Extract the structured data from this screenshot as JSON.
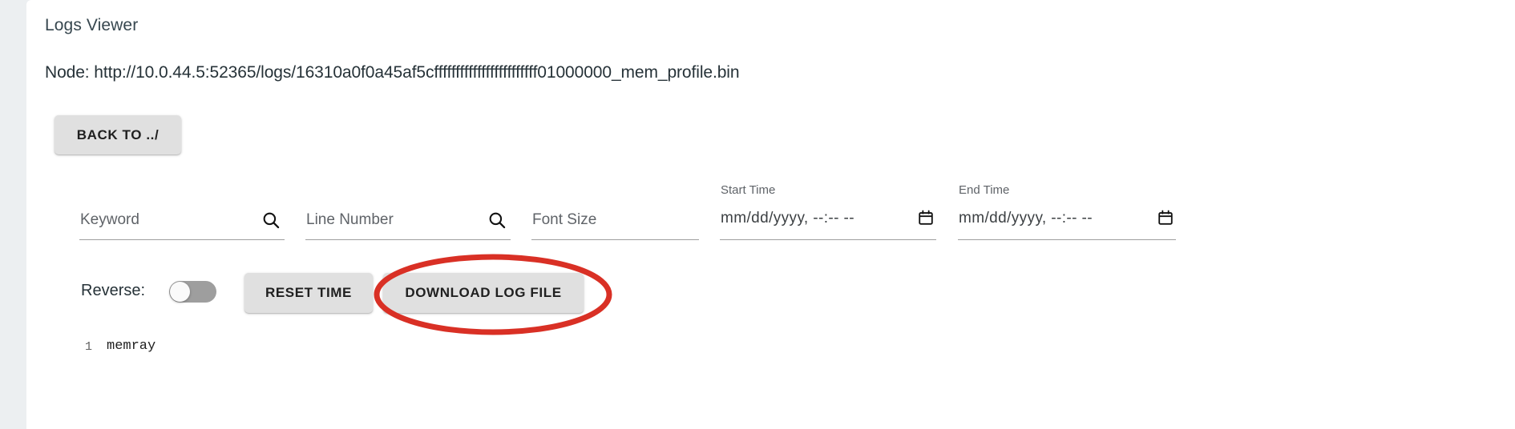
{
  "header": {
    "title": "Logs Viewer",
    "node_line": "Node: http://10.0.44.5:52365/logs/16310a0f0a45af5cffffffffffffffffffffffff01000000_mem_profile.bin"
  },
  "nav": {
    "back_label": "BACK TO ../"
  },
  "filters": {
    "keyword": {
      "placeholder": "Keyword",
      "value": "",
      "icon": "search-icon"
    },
    "line_number": {
      "placeholder": "Line Number",
      "value": "",
      "icon": "search-icon"
    },
    "font_size": {
      "placeholder": "Font Size",
      "value": ""
    },
    "start_time": {
      "label": "Start Time",
      "placeholder": "mm/dd/yyyy, --:-- --",
      "value": "mm/dd/yyyy, --:-- --",
      "icon": "calendar-icon"
    },
    "end_time": {
      "label": "End Time",
      "placeholder": "mm/dd/yyyy, --:-- --",
      "value": "mm/dd/yyyy, --:-- --",
      "icon": "calendar-icon"
    }
  },
  "controls": {
    "reverse_label": "Reverse:",
    "reverse_on": false,
    "reset_time_label": "RESET TIME",
    "download_label": "DOWNLOAD LOG FILE"
  },
  "annotation": {
    "shape": "ellipse",
    "color": "#d93025",
    "targets": "download-log-file-button"
  },
  "log": {
    "lines": [
      {
        "number": "1",
        "text": "memray"
      }
    ]
  },
  "colors": {
    "page_background": "#eceff1",
    "card_background": "#ffffff",
    "button_background": "#e0e0e0",
    "text_primary": "#263238",
    "text_secondary": "#5f6368",
    "annotation_red": "#d93025",
    "toggle_track": "#9e9e9e"
  }
}
